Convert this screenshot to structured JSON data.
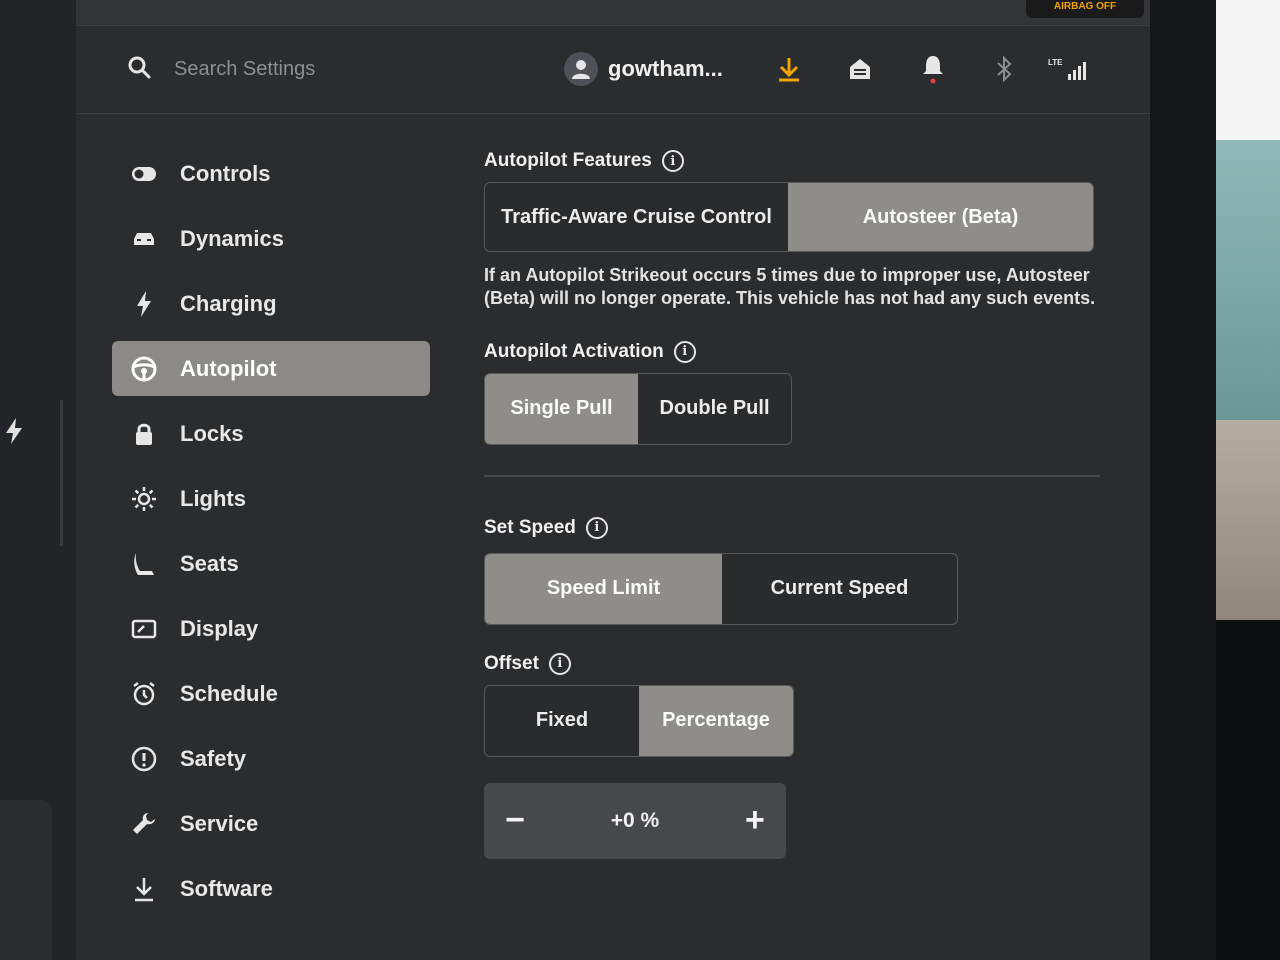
{
  "header": {
    "search_placeholder": "Search Settings",
    "username": "gowtham...",
    "status_icons": [
      "download-icon",
      "garage-icon",
      "bell-icon",
      "bluetooth-icon",
      "lte-signal-icon"
    ],
    "accent_color": "#f2a400"
  },
  "sidebar": {
    "items": [
      {
        "label": "Controls",
        "icon": "toggle-icon"
      },
      {
        "label": "Dynamics",
        "icon": "car-icon"
      },
      {
        "label": "Charging",
        "icon": "bolt-icon"
      },
      {
        "label": "Autopilot",
        "icon": "steering-wheel-icon",
        "active": true
      },
      {
        "label": "Locks",
        "icon": "lock-icon"
      },
      {
        "label": "Lights",
        "icon": "sun-icon"
      },
      {
        "label": "Seats",
        "icon": "seat-icon"
      },
      {
        "label": "Display",
        "icon": "display-icon"
      },
      {
        "label": "Schedule",
        "icon": "alarm-clock-icon"
      },
      {
        "label": "Safety",
        "icon": "alert-circle-icon"
      },
      {
        "label": "Service",
        "icon": "wrench-icon"
      },
      {
        "label": "Software",
        "icon": "download-icon"
      }
    ]
  },
  "autopilot_features": {
    "title": "Autopilot Features",
    "options": [
      "Traffic-Aware Cruise Control",
      "Autosteer (Beta)"
    ],
    "selected": "Autosteer (Beta)",
    "description": "If an Autopilot Strikeout occurs 5 times due to improper use, Autosteer (Beta) will no longer operate. This vehicle has not had any such events."
  },
  "autopilot_activation": {
    "title": "Autopilot Activation",
    "options": [
      "Single Pull",
      "Double Pull"
    ],
    "selected": "Single Pull"
  },
  "set_speed": {
    "title": "Set Speed",
    "options": [
      "Speed Limit",
      "Current Speed"
    ],
    "selected": "Speed Limit"
  },
  "offset": {
    "title": "Offset",
    "options": [
      "Fixed",
      "Percentage"
    ],
    "selected": "Percentage",
    "value": "+0 %",
    "decrement": "−",
    "increment": "+"
  },
  "topstrip": {
    "airbag": "AIRBAG OFF"
  }
}
